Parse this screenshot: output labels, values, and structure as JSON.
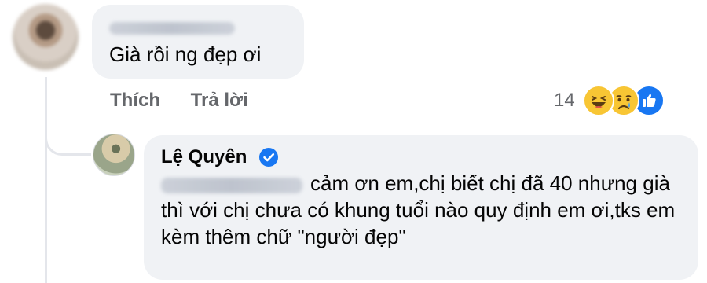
{
  "top_comment": {
    "text": "Già rồi ng đẹp ơi"
  },
  "actions": {
    "like": "Thích",
    "reply": "Trả lời"
  },
  "reactions": {
    "count": "14",
    "icons": [
      "haha-icon",
      "sad-icon",
      "like-icon"
    ]
  },
  "reply_comment": {
    "author": "Lệ Quyên",
    "text": "cảm ơn em,chị biết chị đã 40 nhưng già thì với chị chưa có khung tuổi nào quy định em ơi,tks em kèm thêm chữ \"người đẹp\""
  },
  "colors": {
    "bubble": "#f0f2f5",
    "secondary_text": "#65676b",
    "verified": "#1877f2"
  }
}
